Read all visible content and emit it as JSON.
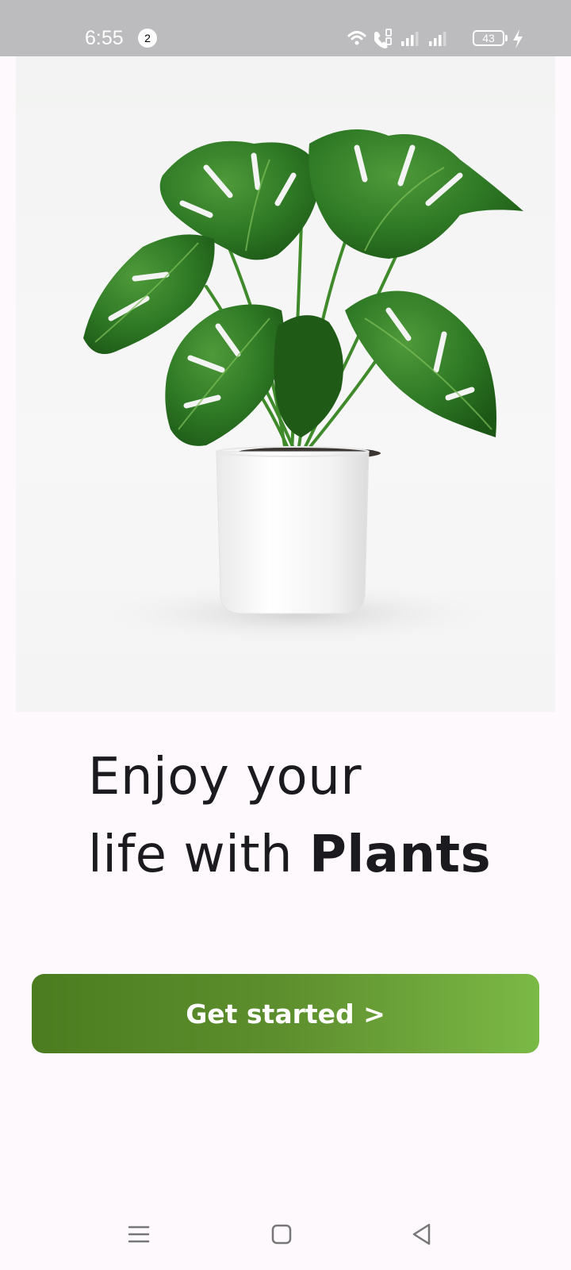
{
  "status_bar": {
    "time": "6:55",
    "notification_count": "2",
    "battery_level": "43",
    "icons": [
      "wifi-icon",
      "wifi-calling-icon",
      "signal-sim1-icon",
      "signal-sim2-icon",
      "battery-icon",
      "charging-icon"
    ]
  },
  "hero": {
    "image": "monstera-plant-in-white-pot"
  },
  "headline": {
    "line1": "Enjoy your",
    "line2_regular": "life with",
    "line2_bold": "Plants"
  },
  "cta": {
    "label": "Get started >",
    "colors": [
      "#4b7c1f",
      "#7bb946"
    ]
  },
  "nav_bar": {
    "buttons": [
      "menu-icon",
      "home-icon",
      "back-icon"
    ]
  },
  "colors": {
    "background": "#fdf9fc",
    "text": "#1b1a1e",
    "status_bar": "#bcbbbd"
  }
}
